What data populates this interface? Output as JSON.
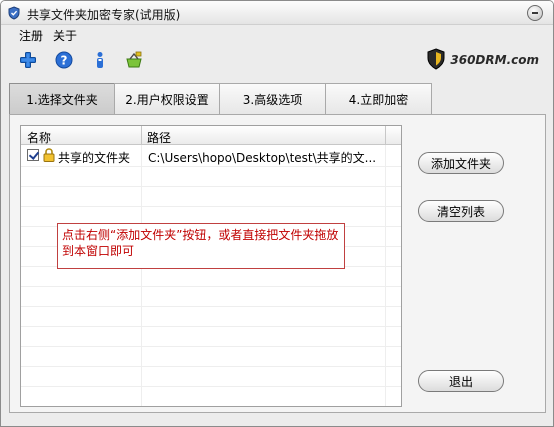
{
  "window": {
    "title": "共享文件夹加密专家(试用版)"
  },
  "menu": [
    {
      "label": "注册"
    },
    {
      "label": "关于"
    }
  ],
  "toolbar": {
    "icons": [
      "plus-icon",
      "help-icon",
      "info-icon",
      "basket-icon"
    ]
  },
  "brand": {
    "text": "360DRM.com",
    "icon": "shield-logo-icon"
  },
  "tabs": [
    {
      "label": "1.选择文件夹",
      "active": true
    },
    {
      "label": "2.用户权限设置",
      "active": false
    },
    {
      "label": "3.高级选项",
      "active": false
    },
    {
      "label": "4.立即加密",
      "active": false
    }
  ],
  "list": {
    "columns": [
      "名称",
      "路径"
    ],
    "rows": [
      {
        "checked": true,
        "icon": "lock-icon",
        "name": "共享的文件夹",
        "path": "C:\\Users\\hopo\\Desktop\\test\\共享的文..."
      }
    ]
  },
  "hint": {
    "text": "点击右侧“添加文件夹”按钮，或者直接把文件夹拖放到本窗口即可"
  },
  "buttons": {
    "add_folder": "添加文件夹",
    "clear_list": "清空列表",
    "exit": "退出"
  },
  "colors": {
    "hint_text": "#c00000",
    "hint_border": "#c04040",
    "tab_active": "#cbcbcb",
    "plus_icon": "#1e6fd0"
  }
}
